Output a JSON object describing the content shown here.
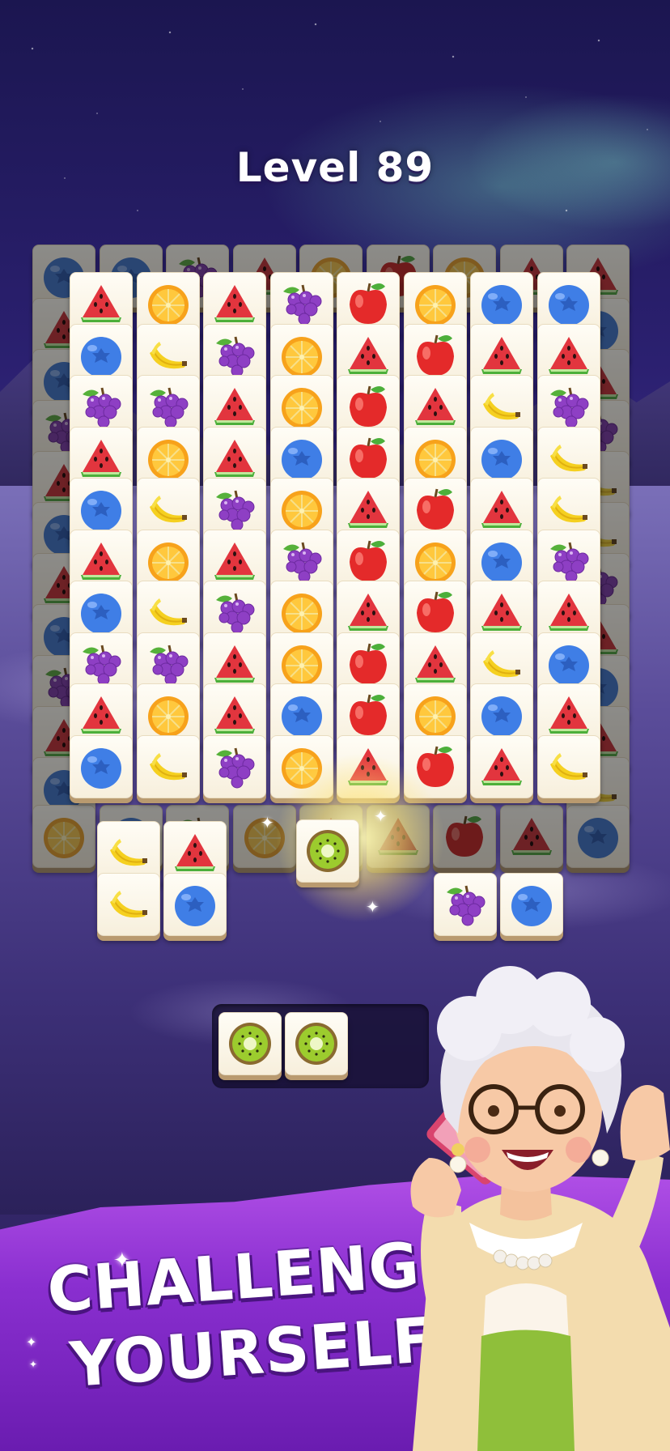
{
  "level": {
    "title": "Level 89"
  },
  "headline": {
    "line1": "CHALLENGE",
    "line2": "YOURSELF"
  },
  "colors": {
    "banner_purple": "#8a2fd0",
    "tile_face": "#fffdf6",
    "tile_edge": "#b99a6f",
    "glow": "#fff7b4"
  },
  "board": {
    "back_row": [
      "blueberry",
      "blueberry",
      "grapes",
      "watermelon",
      "orange",
      "apple",
      "orange",
      "watermelon",
      "watermelon"
    ],
    "front_grid": [
      [
        "watermelon",
        "orange",
        "watermelon",
        "grapes",
        "apple",
        "orange",
        "blueberry",
        "blueberry"
      ],
      [
        "blueberry",
        "banana",
        "grapes",
        "orange",
        "watermelon",
        "apple",
        "watermelon",
        "watermelon"
      ],
      [
        "grapes",
        "grapes",
        "watermelon",
        "orange",
        "apple",
        "watermelon",
        "banana",
        "grapes"
      ],
      [
        "watermelon",
        "orange",
        "watermelon",
        "blueberry",
        "apple",
        "orange",
        "blueberry",
        "banana"
      ],
      [
        "blueberry",
        "banana",
        "grapes",
        "orange",
        "watermelon",
        "apple",
        "watermelon",
        "banana"
      ],
      [
        "watermelon",
        "orange",
        "watermelon",
        "grapes",
        "apple",
        "orange",
        "blueberry",
        "grapes"
      ],
      [
        "blueberry",
        "banana",
        "grapes",
        "orange",
        "watermelon",
        "apple",
        "watermelon",
        "watermelon"
      ],
      [
        "grapes",
        "grapes",
        "watermelon",
        "orange",
        "apple",
        "watermelon",
        "banana",
        "blueberry"
      ],
      [
        "watermelon",
        "orange",
        "watermelon",
        "blueberry",
        "apple",
        "orange",
        "blueberry",
        "watermelon"
      ],
      [
        "blueberry",
        "banana",
        "grapes",
        "orange",
        "watermelon",
        "apple",
        "watermelon",
        "banana"
      ]
    ],
    "bottom_back_row": [
      "orange",
      "blueberry",
      "grapes",
      "orange",
      "watermelon",
      "watermelon",
      "apple",
      "watermelon",
      "blueberry"
    ],
    "loose_left": [
      "banana",
      "watermelon",
      "banana",
      "blueberry"
    ],
    "loose_right": [
      "grapes",
      "blueberry"
    ],
    "selected_tile": "kiwi"
  },
  "tray": {
    "tiles": [
      "kiwi",
      "kiwi"
    ],
    "slots": 3
  },
  "icons": [
    "watermelon-icon",
    "orange-icon",
    "grapes-icon",
    "apple-icon",
    "blueberry-icon",
    "banana-icon",
    "kiwi-icon"
  ]
}
